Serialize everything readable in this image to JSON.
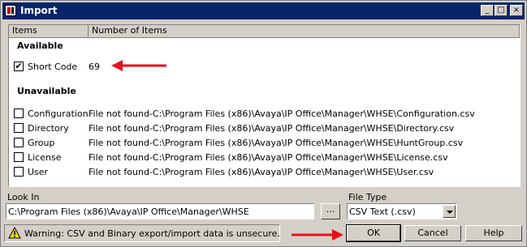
{
  "window": {
    "title": "Import"
  },
  "title_buttons": {
    "minimize": "_",
    "maximize": "□",
    "close": "×"
  },
  "table": {
    "columns": [
      "Items",
      "Number of Items"
    ],
    "available_header": "Available",
    "available": [
      {
        "name": "Short Code",
        "value": "69",
        "checked": true
      }
    ],
    "unavailable_header": "Unavailable",
    "unavailable": [
      {
        "name": "Configuration",
        "value": "File not found-C:\\Program Files (x86)\\Avaya\\IP Office\\Manager\\WHSE\\Configuration.csv"
      },
      {
        "name": "Directory",
        "value": "File not found-C:\\Program Files (x86)\\Avaya\\IP Office\\Manager\\WHSE\\Directory.csv"
      },
      {
        "name": "Group",
        "value": "File not found-C:\\Program Files (x86)\\Avaya\\IP Office\\Manager\\WHSE\\HuntGroup.csv"
      },
      {
        "name": "License",
        "value": "File not found-C:\\Program Files (x86)\\Avaya\\IP Office\\Manager\\WHSE\\License.csv"
      },
      {
        "name": "User",
        "value": "File not found-C:\\Program Files (x86)\\Avaya\\IP Office\\Manager\\WHSE\\User.csv"
      }
    ]
  },
  "look_in": {
    "label": "Look In",
    "value": "C:\\Program Files (x86)\\Avaya\\IP Office\\Manager\\WHSE",
    "browse_label": "..."
  },
  "file_type": {
    "label": "File Type",
    "value": "CSV Text (.csv)"
  },
  "warning": {
    "text": "Warning: CSV and Binary export/import data is unsecure."
  },
  "buttons": {
    "ok": "OK",
    "cancel": "Cancel",
    "help": "Help"
  },
  "colors": {
    "annotation_arrow": "#e8101a",
    "titlebar": "#0a246a"
  },
  "icons": {
    "check": "✔",
    "warning": "warning-icon"
  }
}
